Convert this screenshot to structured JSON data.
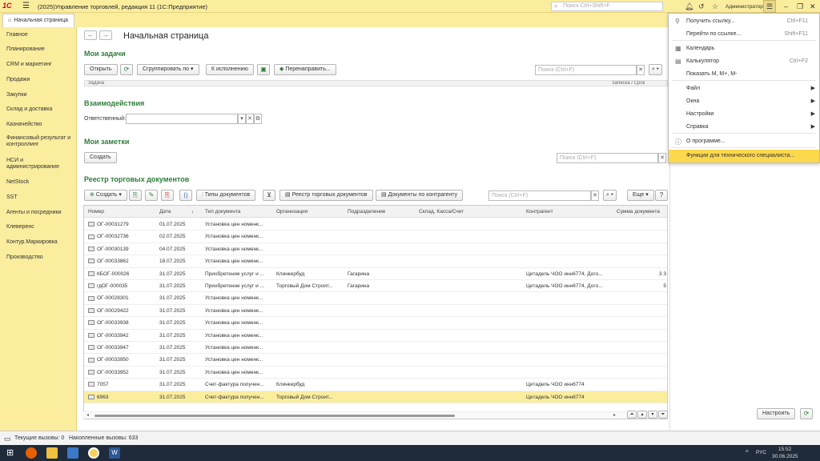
{
  "titlebar": {
    "logo": "1С",
    "app_title": "(2025)Управление торговлей, редакция 11  (1С:Предприятие)",
    "search_placeholder": "Поиск Ctrl+Shift+F",
    "user": "Администратор"
  },
  "tabs": {
    "home": "Начальная страница"
  },
  "sidebar": {
    "items": [
      "Главное",
      "Планирование",
      "CRM и маркетинг",
      "Продажи",
      "Закупки",
      "Склад и доставка",
      "Казначейство",
      "Финансовый результат и контроллинг",
      "НСИ и администрирование",
      "NetStock",
      "SST",
      "Агенты и посредники",
      "Клеверенс",
      "Контур.Маркировка",
      "Производство"
    ]
  },
  "page": {
    "title": "Начальная страница"
  },
  "tasks": {
    "title": "Мои задачи",
    "open": "Открыть",
    "group_by": "Сгруппировать по",
    "to_execute": "К исполнению",
    "redirect": "Перенаправить...",
    "search_placeholder": "Поиск (Ctrl+F)",
    "col_task": "Задача",
    "col_deadline": "Записка / Срок"
  },
  "interactions": {
    "title": "Взаимодействия",
    "responsible_label": "Ответственный:"
  },
  "notes": {
    "title": "Мои заметки",
    "create": "Создать",
    "search_placeholder": "Поиск (Ctrl+F)"
  },
  "registry": {
    "title": "Реестр торговых документов",
    "create": "Создать",
    "doc_types": "Типы документов",
    "registry_btn": "Реестр торговых документов",
    "by_counterparty": "Документы по контрагенту",
    "search_placeholder": "Поиск (Ctrl+F)",
    "more": "Еще",
    "help": "?",
    "columns": [
      "Номер",
      "Дата",
      "Тип документа",
      "Организация",
      "Подразделение",
      "Склад, Касса/Счет",
      "Контрагент",
      "Сумма документа"
    ],
    "rows": [
      {
        "num": "ОГ-00031279",
        "date": "01.07.2025",
        "type": "Установка цен номенк...",
        "org": "",
        "div": "",
        "stock": "",
        "cp": "",
        "sum": ""
      },
      {
        "num": "ОГ-00032736",
        "date": "02.07.2025",
        "type": "Установка цен номенк...",
        "org": "",
        "div": "",
        "stock": "",
        "cp": "",
        "sum": ""
      },
      {
        "num": "ОГ-00030139",
        "date": "04.07.2025",
        "type": "Установка цен номенк...",
        "org": "",
        "div": "",
        "stock": "",
        "cp": "",
        "sum": ""
      },
      {
        "num": "ОГ-00033862",
        "date": "18.07.2025",
        "type": "Установка цен номенк...",
        "org": "",
        "div": "",
        "stock": "",
        "cp": "",
        "sum": ""
      },
      {
        "num": "КБОГ-000026",
        "date": "31.07.2025",
        "type": "Приобретение услуг и ...",
        "org": "Клинкербуд",
        "div": "Гагарина",
        "stock": "",
        "cp": "Цитадель ЧОО инн6774, Дого...",
        "sum": "3 3"
      },
      {
        "num": "гдОГ-000035",
        "date": "31.07.2025",
        "type": "Приобретение услуг и ...",
        "org": "Торговый Дом  Строит...",
        "div": "Гагарина",
        "stock": "",
        "cp": "Цитадель ЧОО инн6774, Дого...",
        "sum": "5"
      },
      {
        "num": "ОГ-00028301",
        "date": "31.07.2025",
        "type": "Установка цен номенк...",
        "org": "",
        "div": "",
        "stock": "",
        "cp": "",
        "sum": ""
      },
      {
        "num": "ОГ-00029422",
        "date": "31.07.2025",
        "type": "Установка цен номенк...",
        "org": "",
        "div": "",
        "stock": "",
        "cp": "",
        "sum": ""
      },
      {
        "num": "ОГ-00033938",
        "date": "31.07.2025",
        "type": "Установка цен номенк...",
        "org": "",
        "div": "",
        "stock": "",
        "cp": "",
        "sum": ""
      },
      {
        "num": "ОГ-00033942",
        "date": "31.07.2025",
        "type": "Установка цен номенк...",
        "org": "",
        "div": "",
        "stock": "",
        "cp": "",
        "sum": ""
      },
      {
        "num": "ОГ-00033947",
        "date": "31.07.2025",
        "type": "Установка цен номенк...",
        "org": "",
        "div": "",
        "stock": "",
        "cp": "",
        "sum": ""
      },
      {
        "num": "ОГ-00033950",
        "date": "31.07.2025",
        "type": "Установка цен номенк...",
        "org": "",
        "div": "",
        "stock": "",
        "cp": "",
        "sum": ""
      },
      {
        "num": "ОГ-00033952",
        "date": "31.07.2025",
        "type": "Установка цен номенк...",
        "org": "",
        "div": "",
        "stock": "",
        "cp": "",
        "sum": ""
      },
      {
        "num": "7057",
        "date": "31.07.2025",
        "type": "Счет-фактура получен...",
        "org": "Клинкербуд",
        "div": "",
        "stock": "",
        "cp": "Цитадель ЧОО инн6774",
        "sum": ""
      },
      {
        "num": "6963",
        "date": "31.07.2025",
        "type": "Счет-фактура получен...",
        "org": "Торговый Дом  Строит...",
        "div": "",
        "stock": "",
        "cp": "Цитадель ЧОО инн6774",
        "sum": ""
      }
    ],
    "selected_row": 14
  },
  "dropdown": {
    "items": [
      {
        "label": "Получить ссылку...",
        "shortcut": "Ctrl+F11",
        "icon": "link-icon",
        "arrow": false
      },
      {
        "label": "Перейти по ссылке...",
        "shortcut": "Shift+F11",
        "icon": "",
        "arrow": false
      },
      {
        "label": "Календарь",
        "shortcut": "",
        "icon": "calendar-icon",
        "arrow": false
      },
      {
        "label": "Калькулятор",
        "shortcut": "Ctrl+F2",
        "icon": "calculator-icon",
        "arrow": false
      },
      {
        "label": "Показать М, М+, М-",
        "shortcut": "",
        "icon": "",
        "arrow": false
      },
      {
        "label": "Файл",
        "shortcut": "",
        "icon": "",
        "arrow": true
      },
      {
        "label": "Окна",
        "shortcut": "",
        "icon": "",
        "arrow": true
      },
      {
        "label": "Настройки",
        "shortcut": "",
        "icon": "",
        "arrow": true
      },
      {
        "label": "Справка",
        "shortcut": "",
        "icon": "",
        "arrow": true
      },
      {
        "label": "О программе...",
        "shortcut": "",
        "icon": "info-icon",
        "arrow": false
      },
      {
        "label": "Функции для технического специалиста...",
        "shortcut": "",
        "icon": "",
        "arrow": false
      }
    ],
    "highlighted": 10
  },
  "rightpanel": {
    "configure": "Настроить"
  },
  "statusbar": {
    "current_calls": "Текущие вызовы: 0",
    "accumulated_calls": "Накопленные вызовы: 633"
  },
  "taskbar": {
    "lang": "РУС",
    "time": "15:52",
    "date": "30.06.2025"
  },
  "colors": {
    "accent": "#fbed9e",
    "section": "#2f7d3a",
    "highlight": "#fcd84c"
  }
}
